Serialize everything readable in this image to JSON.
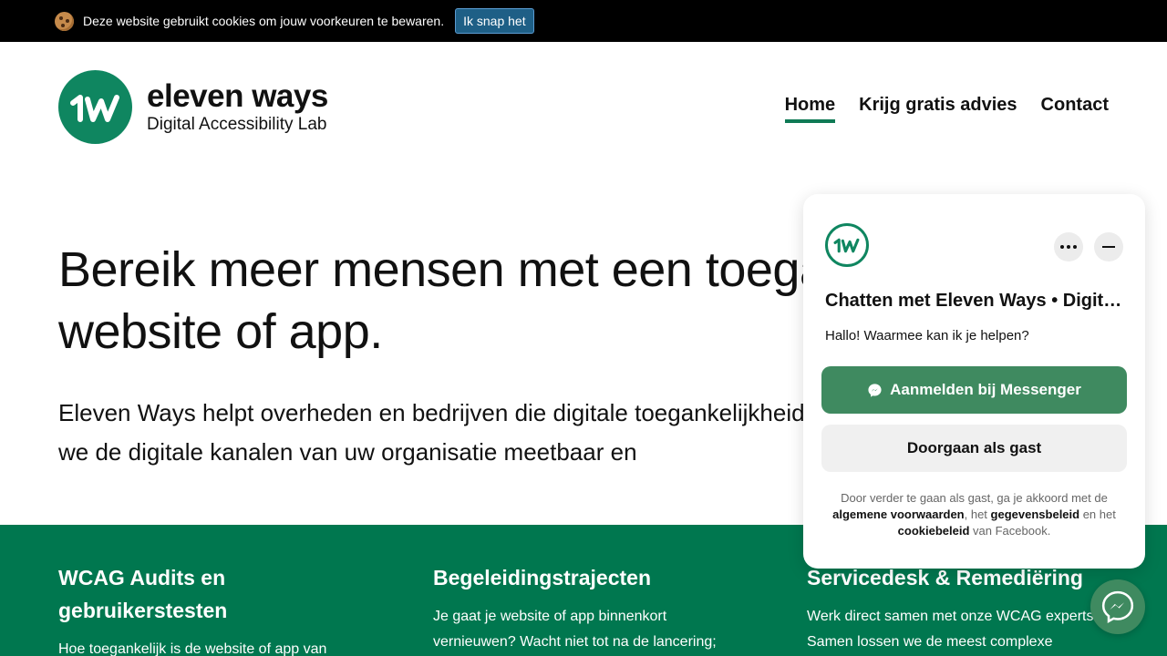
{
  "cookie_bar": {
    "text": "Deze website gebruikt cookies om jouw voorkeuren te bewaren.",
    "button_label": "Ik snap het"
  },
  "logo": {
    "mark": "1W",
    "name": "eleven ways",
    "subtitle": "Digital Accessibility Lab",
    "brand_color": "#0f8660"
  },
  "nav": {
    "items": [
      {
        "label": "Home",
        "active": true
      },
      {
        "label": "Krijg gratis advies",
        "active": false
      },
      {
        "label": "Contact",
        "active": false
      }
    ]
  },
  "hero": {
    "title": "Bereik meer mensen met een toegankelijke website of app.",
    "text": "Eleven Ways helpt overheden en bedrijven die digitale toegankelijkheid serieus nemen. Samen maken we de digitale kanalen van uw organisatie meetbaar en"
  },
  "services": {
    "background": "#00774f",
    "columns": [
      {
        "title": "WCAG Audits en gebruikerstesten",
        "text": "Hoe toegankelijk is de website of app van"
      },
      {
        "title": "Begeleidingstrajecten",
        "text": "Je gaat je website of app binnenkort vernieuwen? Wacht niet tot na de lancering;"
      },
      {
        "title": "Servicedesk & Remediëring",
        "text": "Werk direct samen met onze WCAG experts. Samen lossen we de meest complexe"
      }
    ]
  },
  "chat": {
    "title": "Chatten met Eleven Ways • Digital Accessibility Lab",
    "greeting": "Hallo! Waarmee kan ik je helpen?",
    "messenger_button": "Aanmelden bij Messenger",
    "guest_button": "Doorgaan als gast",
    "legal": {
      "part1": "Door verder te gaan als gast, ga je akkoord met de ",
      "link1": "algemene voorwaarden",
      "part2": ", het ",
      "link2": "gegevensbeleid",
      "part3": " en het ",
      "link3": "cookiebeleid",
      "part4": " van Facebook."
    },
    "accent_color": "#3f8a60"
  },
  "icons": {
    "cookie": "cookie-icon",
    "more": "more-options-icon",
    "minimize": "minimize-icon",
    "messenger": "messenger-icon"
  }
}
